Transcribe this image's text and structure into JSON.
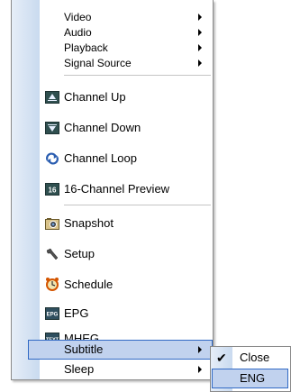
{
  "menu": {
    "items": [
      {
        "label": "Video",
        "submenu": true
      },
      {
        "label": "Audio",
        "submenu": true
      },
      {
        "label": "Playback",
        "submenu": true
      },
      {
        "label": "Signal Source",
        "submenu": true
      },
      {
        "label": "Channel Up",
        "icon": "channel-up-icon"
      },
      {
        "label": "Channel Down",
        "icon": "channel-down-icon"
      },
      {
        "label": "Channel Loop",
        "icon": "channel-loop-icon"
      },
      {
        "label": "16-Channel Preview",
        "icon": "sixteen-channel-icon"
      },
      {
        "label": "Snapshot",
        "icon": "camera-icon"
      },
      {
        "label": "Setup",
        "icon": "wrench-icon"
      },
      {
        "label": "Schedule",
        "icon": "alarm-clock-icon"
      },
      {
        "label": "EPG",
        "icon": "epg-icon"
      },
      {
        "label": "MHEG",
        "icon": "text-icon"
      },
      {
        "label": "Subtitle",
        "submenu": true,
        "highlighted": true
      },
      {
        "label": "Sleep",
        "submenu": true
      }
    ]
  },
  "icon_text": {
    "sixteen": "16",
    "epg": "EPG",
    "mheg": "TEXT"
  },
  "subtitle_submenu": {
    "items": [
      {
        "label": "Close",
        "checked": true
      },
      {
        "label": "ENG",
        "highlighted": true
      }
    ]
  },
  "colors": {
    "highlight_fill": "#c1d2ee",
    "highlight_border": "#316ac5",
    "gutter": "#c9daef"
  }
}
